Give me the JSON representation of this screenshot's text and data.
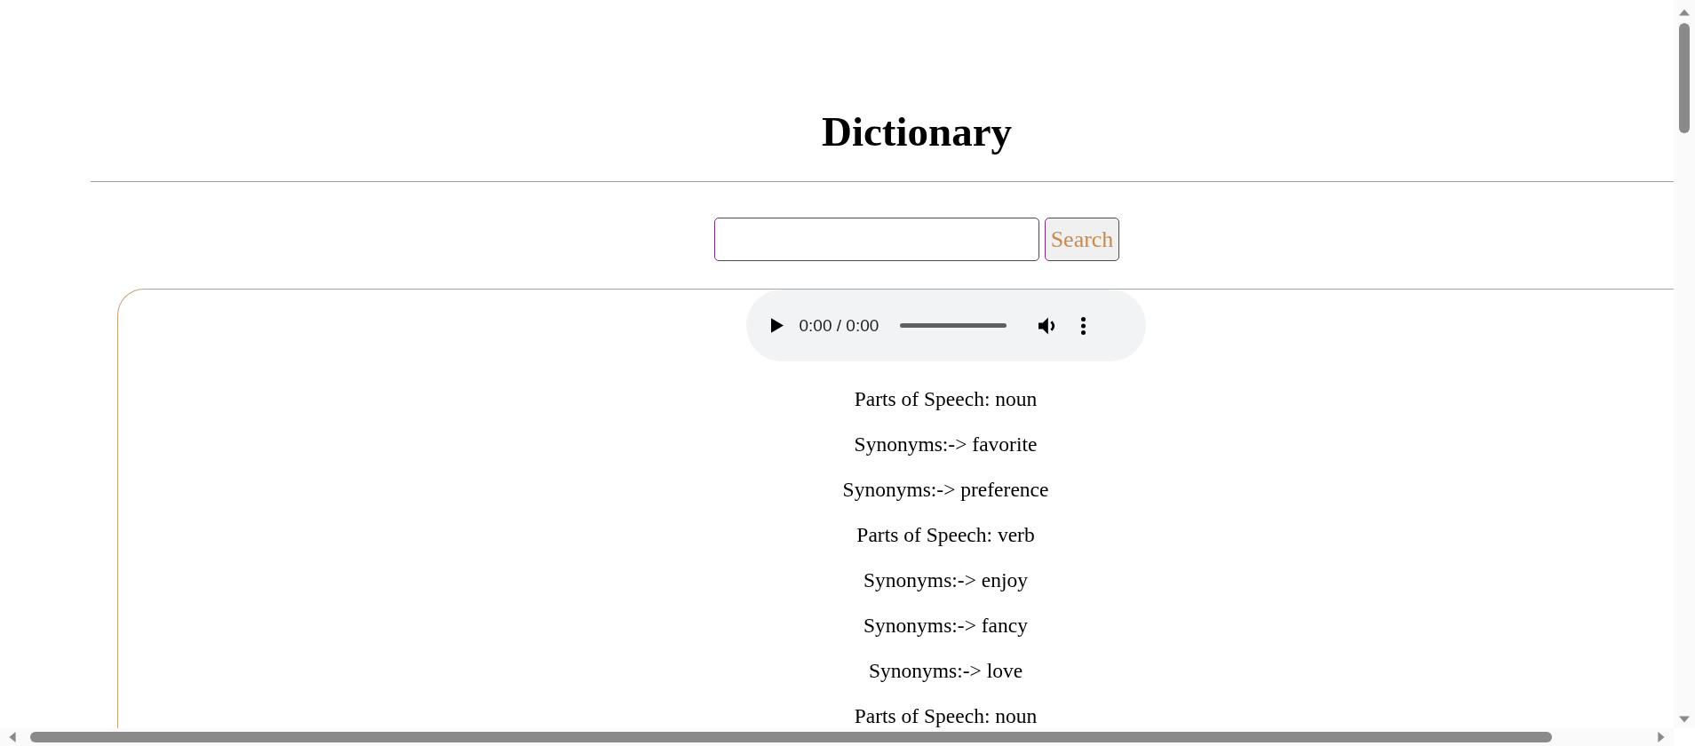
{
  "title": "Dictionary",
  "search": {
    "button": "Search"
  },
  "audio": {
    "time": "0:00 / 0:00",
    "level": 0
  },
  "entries": [
    "Parts of Speech: noun",
    "Synonyms:-> favorite",
    "Synonyms:-> preference",
    "Parts of Speech: verb",
    "Synonyms:-> enjoy",
    "Synonyms:-> fancy",
    "Synonyms:-> love",
    "Parts of Speech: noun"
  ]
}
